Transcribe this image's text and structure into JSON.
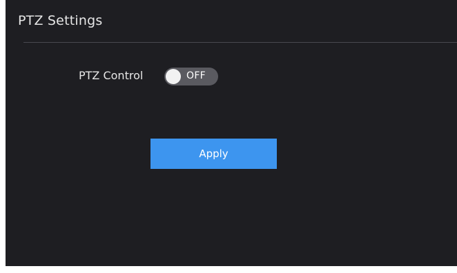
{
  "header": {
    "title": "PTZ Settings"
  },
  "form": {
    "ptz_control": {
      "label": "PTZ Control",
      "state_text": "OFF",
      "enabled": false
    },
    "apply_label": "Apply"
  },
  "colors": {
    "panel_background": "#1e1e22",
    "accent": "#3d95ef",
    "toggle_off_track": "#5a5a60",
    "text": "#e6e6e6"
  }
}
